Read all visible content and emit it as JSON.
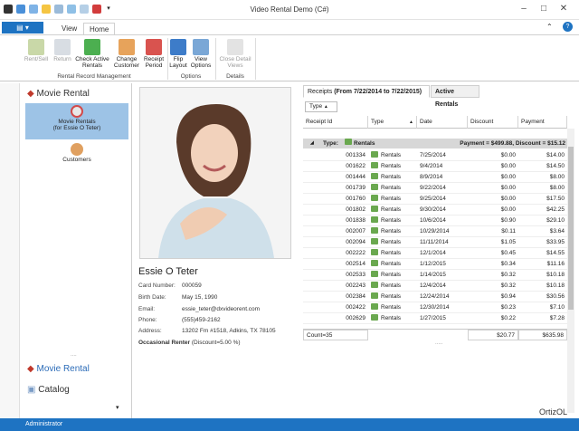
{
  "window": {
    "title": "Video Rental Demo (C#)"
  },
  "tabs": {
    "file": "",
    "view": "View",
    "home": "Home"
  },
  "ribbon": {
    "buttons": [
      {
        "label1": "Rent/Sell",
        "label2": ""
      },
      {
        "label1": "Return",
        "label2": ""
      },
      {
        "label1": "Check Active",
        "label2": "Rentals"
      },
      {
        "label1": "Change",
        "label2": "Customer"
      },
      {
        "label1": "Receipt",
        "label2": "Period"
      },
      {
        "label1": "Flip",
        "label2": "Layout"
      },
      {
        "label1": "View",
        "label2": "Options"
      },
      {
        "label1": "Close Detail",
        "label2": "Views"
      }
    ],
    "groups": {
      "rental": "Rental Record Management",
      "options": "Options",
      "details": "Details"
    }
  },
  "nav": {
    "header": "Movie Rental",
    "items": [
      {
        "label1": "Movie Rentals",
        "label2": "(for Essie O Teter)"
      },
      {
        "label1": "Customers",
        "label2": ""
      }
    ],
    "bottom": [
      "Movie Rental",
      "Catalog"
    ]
  },
  "customer": {
    "name": "Essie O Teter",
    "rows": [
      {
        "label": "Card Number:",
        "value": "000059"
      },
      {
        "label": "Birth Date:",
        "value": "May 15, 1990"
      },
      {
        "label": "Email:",
        "value": "essie_teter@dxvideorent.com"
      },
      {
        "label": "Phone:",
        "value": "(555)459-2162"
      },
      {
        "label": "Address:",
        "value": "13202 Fm #1518,  Adkins, TX 78105"
      }
    ],
    "renter": "Occasional Renter",
    "discount": "(Discount=5.00 %)"
  },
  "grid": {
    "tab_receipts_prefix": "Receipts",
    "tab_receipts_range": "(From 7/22/2014 to 7/22/2015)",
    "tab_active": "Active Rentals",
    "filter": "Type",
    "columns": [
      "Receipt Id",
      "Type",
      "Date",
      "Discount",
      "Payment"
    ],
    "group": {
      "label": "Type:",
      "value": "Rentals",
      "summary": "Payment = $499.88, Discount = $15.12"
    },
    "rows": [
      [
        "001334",
        "Rentals",
        "7/25/2014",
        "$0.00",
        "$14.00"
      ],
      [
        "001622",
        "Rentals",
        "9/4/2014",
        "$0.00",
        "$14.50"
      ],
      [
        "001444",
        "Rentals",
        "8/9/2014",
        "$0.00",
        "$8.00"
      ],
      [
        "001739",
        "Rentals",
        "9/22/2014",
        "$0.00",
        "$8.00"
      ],
      [
        "001760",
        "Rentals",
        "9/25/2014",
        "$0.00",
        "$17.50"
      ],
      [
        "001802",
        "Rentals",
        "9/30/2014",
        "$0.00",
        "$42.25"
      ],
      [
        "001838",
        "Rentals",
        "10/6/2014",
        "$0.90",
        "$29.10"
      ],
      [
        "002007",
        "Rentals",
        "10/29/2014",
        "$0.11",
        "$3.64"
      ],
      [
        "002094",
        "Rentals",
        "11/11/2014",
        "$1.05",
        "$33.95"
      ],
      [
        "002222",
        "Rentals",
        "12/1/2014",
        "$0.45",
        "$14.55"
      ],
      [
        "002514",
        "Rentals",
        "1/12/2015",
        "$0.34",
        "$11.16"
      ],
      [
        "002533",
        "Rentals",
        "1/14/2015",
        "$0.32",
        "$10.18"
      ],
      [
        "002243",
        "Rentals",
        "12/4/2014",
        "$0.32",
        "$10.18"
      ],
      [
        "002384",
        "Rentals",
        "12/24/2014",
        "$0.94",
        "$30.56"
      ],
      [
        "002422",
        "Rentals",
        "12/30/2014",
        "$0.23",
        "$7.10"
      ],
      [
        "002629",
        "Rentals",
        "1/27/2015",
        "$0.22",
        "$7.28"
      ]
    ],
    "footer": {
      "count": "Count=35",
      "discount": "$20.77",
      "payment": "$635.98"
    }
  },
  "status": {
    "user": "Administrator",
    "brand": "OrtizOL"
  }
}
